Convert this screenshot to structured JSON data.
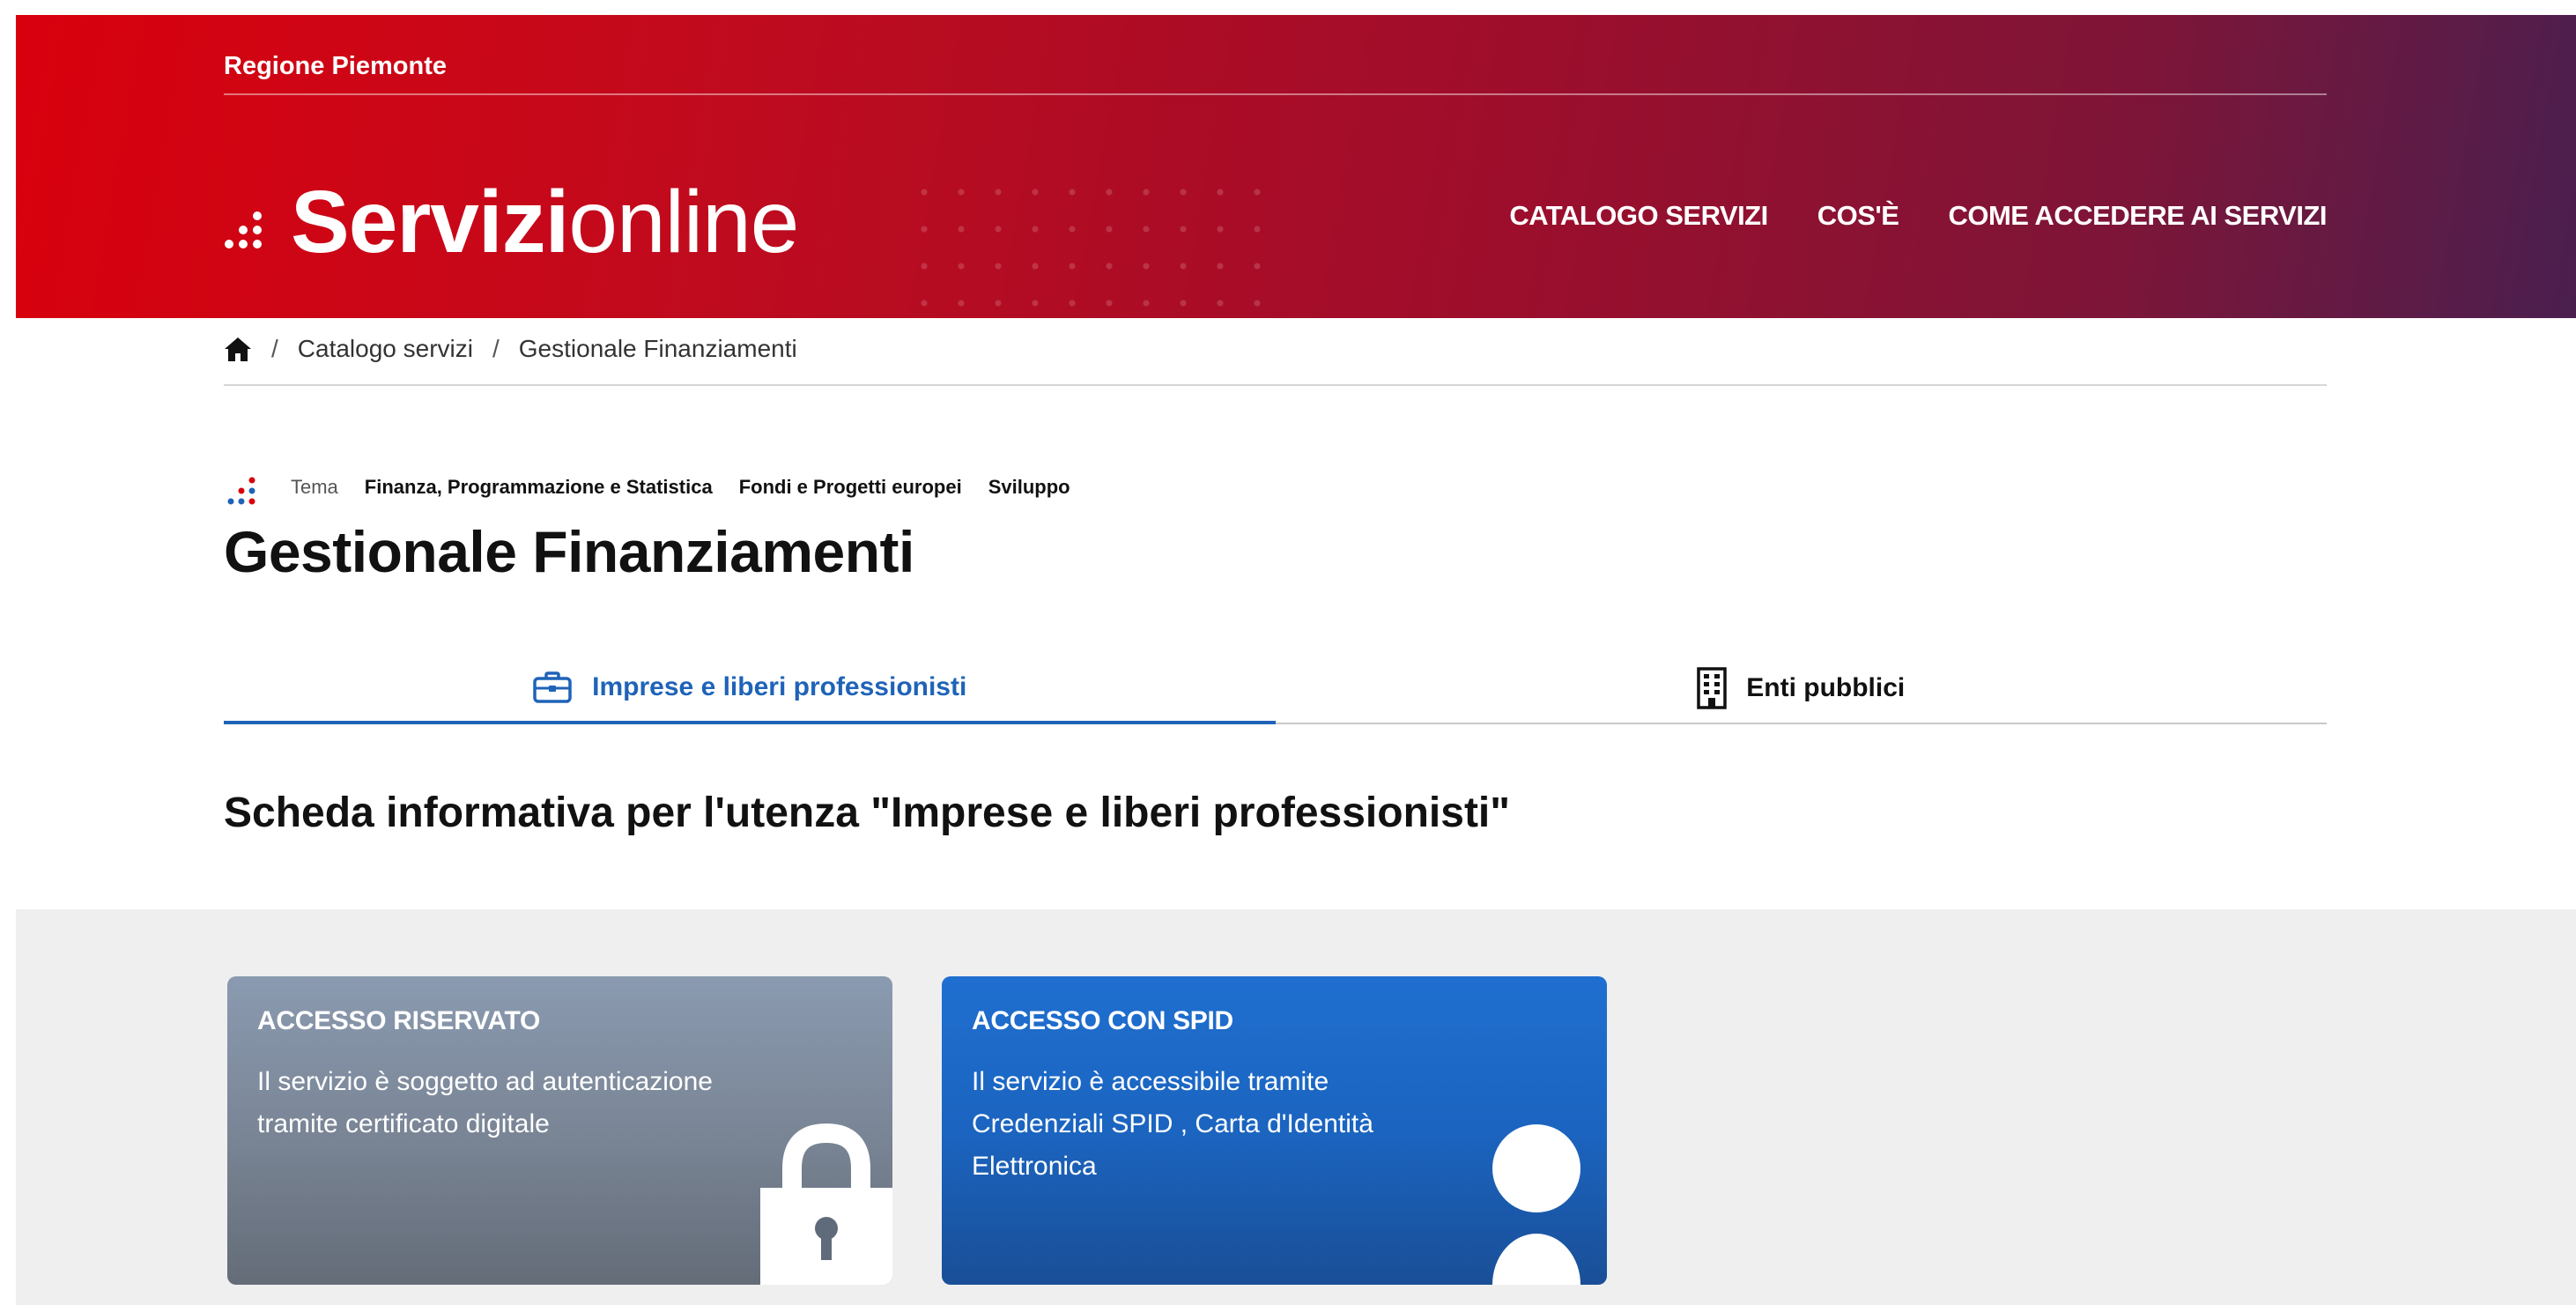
{
  "header": {
    "region": "Regione Piemonte",
    "brand_strong": "Servizi",
    "brand_light": "online",
    "nav": [
      {
        "label": "CATALOGO SERVIZI"
      },
      {
        "label": "COS'È"
      },
      {
        "label": "COME ACCEDERE AI SERVIZI"
      }
    ]
  },
  "breadcrumb": {
    "items": [
      "Catalogo servizi",
      "Gestionale Finanziamenti"
    ]
  },
  "theme": {
    "label": "Tema",
    "tags": [
      "Finanza, Programmazione e Statistica",
      "Fondi e Progetti europei",
      "Sviluppo"
    ]
  },
  "page": {
    "title": "Gestionale Finanziamenti",
    "section_title": "Scheda informativa per l'utenza \"Imprese e liberi professionisti\""
  },
  "tabs": [
    {
      "label": "Imprese e liberi professionisti",
      "icon": "briefcase-icon",
      "active": true
    },
    {
      "label": "Enti pubblici",
      "icon": "building-icon",
      "active": false
    }
  ],
  "cards": [
    {
      "title": "ACCESSO RISERVATO",
      "description": "Il servizio è soggetto ad autenticazione tramite certificato digitale",
      "icon": "lock-icon"
    },
    {
      "title": "ACCESSO CON SPID",
      "description": "Il servizio è accessibile tramite Credenziali SPID , Carta d'Identità Elettronica",
      "icon": "user-icon"
    }
  ],
  "colors": {
    "header_start": "#d9000d",
    "header_end": "#4a1f4f",
    "tab_active": "#1f63b8",
    "card_reserved": "#7c8899",
    "card_spid": "#1b64c0"
  }
}
